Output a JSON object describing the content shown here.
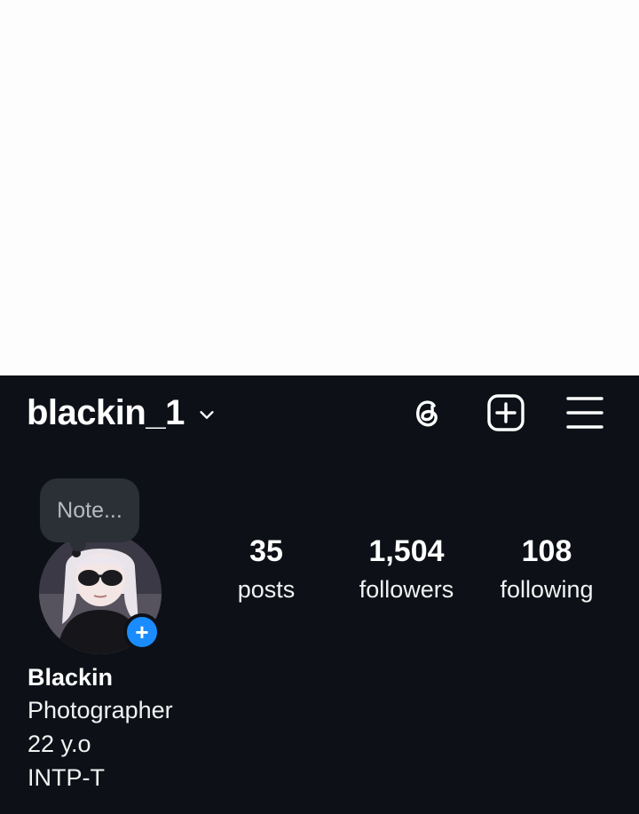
{
  "header": {
    "username": "blackin_1",
    "icons": [
      "threads-icon",
      "add-post-icon",
      "menu-icon",
      "chevron-down-icon"
    ]
  },
  "note": {
    "placeholder": "Note..."
  },
  "avatar": {
    "add_story_symbol": "+"
  },
  "stats": {
    "posts": {
      "count": "35",
      "label": "posts"
    },
    "followers": {
      "count": "1,504",
      "label": "followers"
    },
    "following": {
      "count": "108",
      "label": "following"
    }
  },
  "bio": {
    "name": "Blackin",
    "lines": [
      "Photographer",
      "22 y.o",
      "INTP-T"
    ]
  },
  "colors": {
    "background": "#0d1117",
    "accent": "#1a8cff",
    "note_bubble": "#2b2f36"
  }
}
